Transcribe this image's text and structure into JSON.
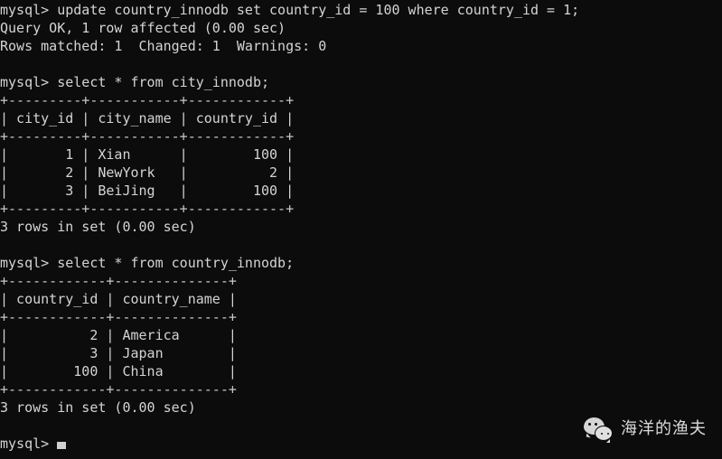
{
  "terminal": {
    "app": "mysql-client-terminal",
    "background_color": "#0c0c0c",
    "foreground_color": "#d4d4d4",
    "prompt": "mysql>",
    "cursor_visible": true,
    "lines": [
      "mysql> update country_innodb set country_id = 100 where country_id = 1;",
      "Query OK, 1 row affected (0.00 sec)",
      "Rows matched: 1  Changed: 1  Warnings: 0",
      "",
      "mysql> select * from city_innodb;",
      "+---------+-----------+------------+",
      "| city_id | city_name | country_id |",
      "+---------+-----------+------------+",
      "|       1 | Xian      |        100 |",
      "|       2 | NewYork   |          2 |",
      "|       3 | BeiJing   |        100 |",
      "+---------+-----------+------------+",
      "3 rows in set (0.00 sec)",
      "",
      "mysql> select * from country_innodb;",
      "+------------+--------------+",
      "| country_id | country_name |",
      "+------------+--------------+",
      "|          2 | America      |",
      "|          3 | Japan        |",
      "|        100 | China        |",
      "+------------+--------------+",
      "3 rows in set (0.00 sec)",
      "",
      "mysql> "
    ]
  },
  "commands": {
    "update_statement": "update country_innodb set country_id = 100 where country_id = 1;",
    "update_result": "Query OK, 1 row affected (0.00 sec)",
    "update_detail": "Rows matched: 1  Changed: 1  Warnings: 0",
    "select_city": "select * from city_innodb;",
    "select_country": "select * from country_innodb;",
    "city_rows_status": "3 rows in set (0.00 sec)",
    "country_rows_status": "3 rows in set (0.00 sec)"
  },
  "tables": {
    "city_innodb": {
      "name": "city_innodb",
      "columns": [
        "city_id",
        "city_name",
        "country_id"
      ],
      "rows": [
        [
          "1",
          "Xian",
          "100"
        ],
        [
          "2",
          "NewYork",
          "2"
        ],
        [
          "3",
          "BeiJing",
          "100"
        ]
      ],
      "row_count_text": "3 rows in set (0.00 sec)"
    },
    "country_innodb": {
      "name": "country_innodb",
      "columns": [
        "country_id",
        "country_name"
      ],
      "rows": [
        [
          "2",
          "America"
        ],
        [
          "3",
          "Japan"
        ],
        [
          "100",
          "China"
        ]
      ],
      "row_count_text": "3 rows in set (0.00 sec)"
    }
  },
  "watermark": {
    "icon": "wechat-logo-icon",
    "text": "海洋的渔夫"
  }
}
